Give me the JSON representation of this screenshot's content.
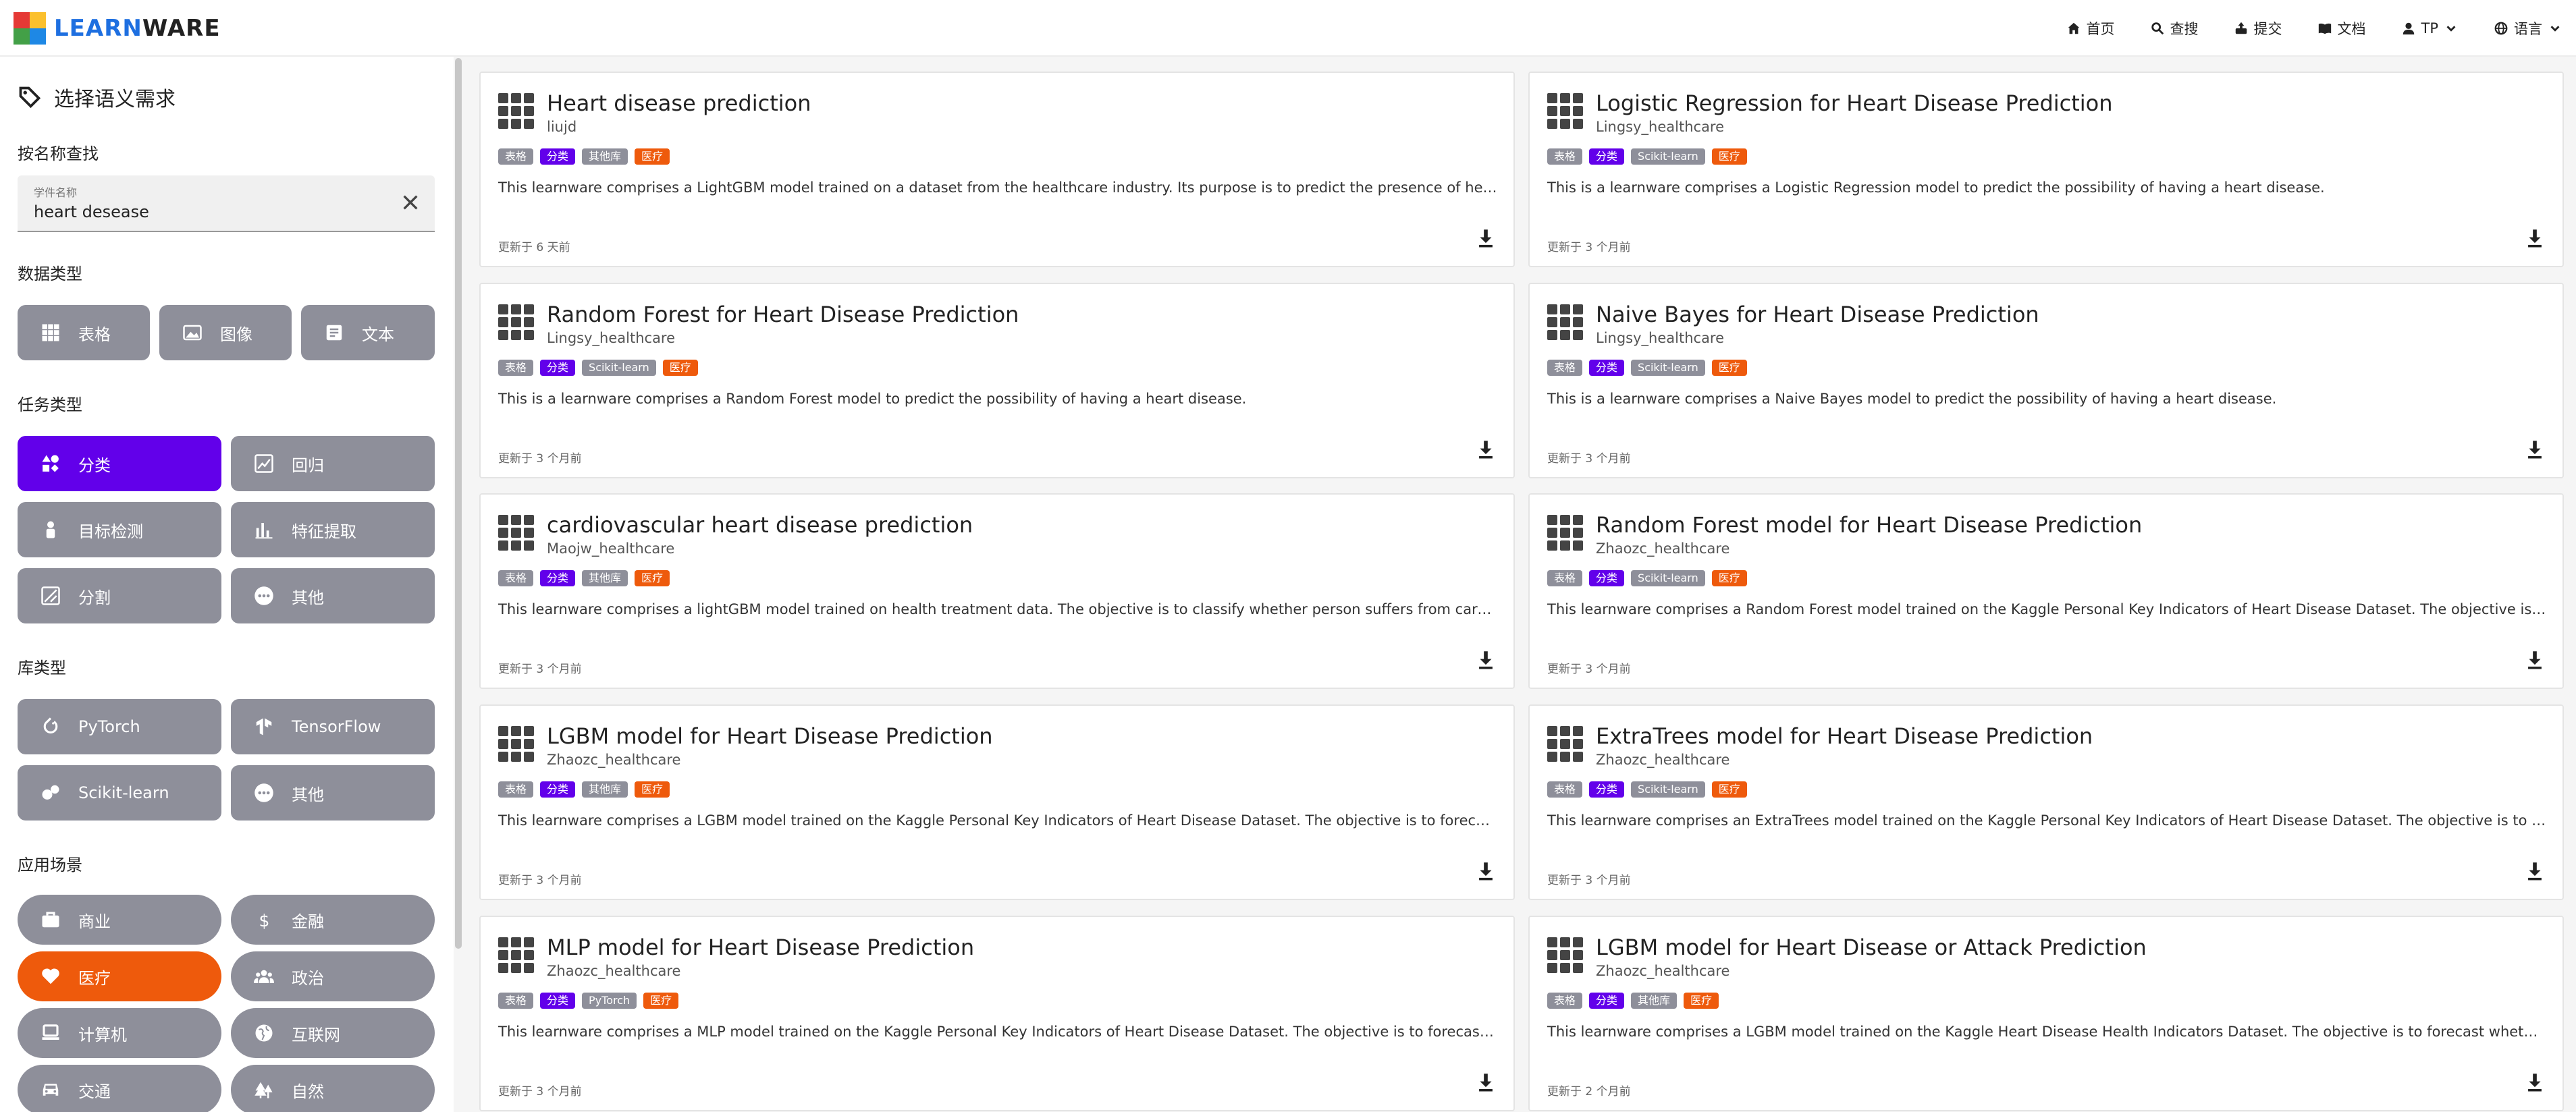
{
  "app": {
    "logo_part1": "LEARN",
    "logo_part2": "WARE"
  },
  "nav": {
    "home": "首页",
    "search": "查搜",
    "submit": "提交",
    "docs": "文档",
    "user": "TP",
    "lang": "语言"
  },
  "sidebar": {
    "title": "选择语义需求",
    "name_search_label": "按名称查找",
    "search_field_label": "学件名称",
    "search_value": "heart desease",
    "data_type_label": "数据类型",
    "data_types": [
      "表格",
      "图像",
      "文本"
    ],
    "task_type_label": "任务类型",
    "task_types": [
      "分类",
      "回归",
      "目标检测",
      "特征提取",
      "分割",
      "其他"
    ],
    "library_label": "库类型",
    "libraries": [
      "PyTorch",
      "TensorFlow",
      "Scikit-learn",
      "其他"
    ],
    "scenario_label": "应用场景",
    "scenarios": [
      "商业",
      "金融",
      "医疗",
      "政治",
      "计算机",
      "互联网",
      "交通",
      "自然"
    ]
  },
  "cards": [
    {
      "title": "Heart disease prediction",
      "author": "liujd",
      "tags": [
        "表格",
        "分类",
        "其他库",
        "医疗"
      ],
      "desc": "This learnware comprises a LightGBM model trained on a dataset from the healthcare industry. Its purpose is to predict the presence of hea...",
      "updated": "更新于 6 天前"
    },
    {
      "title": "Logistic Regression for Heart Disease Prediction",
      "author": "Lingsy_healthcare",
      "tags": [
        "表格",
        "分类",
        "Scikit-learn",
        "医疗"
      ],
      "desc": "This is a learnware comprises a Logistic Regression model to predict the possibility of having a heart disease.",
      "updated": "更新于 3 个月前"
    },
    {
      "title": "Random Forest for Heart Disease Prediction",
      "author": "Lingsy_healthcare",
      "tags": [
        "表格",
        "分类",
        "Scikit-learn",
        "医疗"
      ],
      "desc": "This is a learnware comprises a Random Forest model to predict the possibility of having a heart disease.",
      "updated": "更新于 3 个月前"
    },
    {
      "title": "Naive Bayes for Heart Disease Prediction",
      "author": "Lingsy_healthcare",
      "tags": [
        "表格",
        "分类",
        "Scikit-learn",
        "医疗"
      ],
      "desc": "This is a learnware comprises a Naive Bayes model to predict the possibility of having a heart disease.",
      "updated": "更新于 3 个月前"
    },
    {
      "title": "cardiovascular heart disease prediction",
      "author": "Maojw_healthcare",
      "tags": [
        "表格",
        "分类",
        "其他库",
        "医疗"
      ],
      "desc": "This learnware comprises a lightGBM model trained on health treatment data. The objective is to classify whether person suffers from cardi...",
      "updated": "更新于 3 个月前"
    },
    {
      "title": "Random Forest model for Heart Disease Prediction",
      "author": "Zhaozc_healthcare",
      "tags": [
        "表格",
        "分类",
        "Scikit-learn",
        "医疗"
      ],
      "desc": "This learnware comprises a Random Forest model trained on the Kaggle Personal Key Indicators of Heart Disease Dataset. The objective is t...",
      "updated": "更新于 3 个月前"
    },
    {
      "title": "LGBM model for Heart Disease Prediction",
      "author": "Zhaozc_healthcare",
      "tags": [
        "表格",
        "分类",
        "其他库",
        "医疗"
      ],
      "desc": "This learnware comprises a LGBM model trained on the Kaggle Personal Key Indicators of Heart Disease Dataset. The objective is to forecast...",
      "updated": "更新于 3 个月前"
    },
    {
      "title": "ExtraTrees model for Heart Disease Prediction",
      "author": "Zhaozc_healthcare",
      "tags": [
        "表格",
        "分类",
        "Scikit-learn",
        "医疗"
      ],
      "desc": "This learnware comprises an ExtraTrees model trained on the Kaggle Personal Key Indicators of Heart Disease Dataset. The objective is to fo...",
      "updated": "更新于 3 个月前"
    },
    {
      "title": "MLP model for Heart Disease Prediction",
      "author": "Zhaozc_healthcare",
      "tags": [
        "表格",
        "分类",
        "PyTorch",
        "医疗"
      ],
      "desc": "This learnware comprises a MLP model trained on the Kaggle Personal Key Indicators of Heart Disease Dataset. The objective is to forecast ...",
      "updated": "更新于 3 个月前"
    },
    {
      "title": "LGBM model for Heart Disease or Attack Prediction",
      "author": "Zhaozc_healthcare",
      "tags": [
        "表格",
        "分类",
        "其他库",
        "医疗"
      ],
      "desc": "This learnware comprises a LGBM model trained on the Kaggle Heart Disease Health Indicators Dataset. The objective is to forecast whether...",
      "updated": "更新于 2 个月前"
    }
  ]
}
